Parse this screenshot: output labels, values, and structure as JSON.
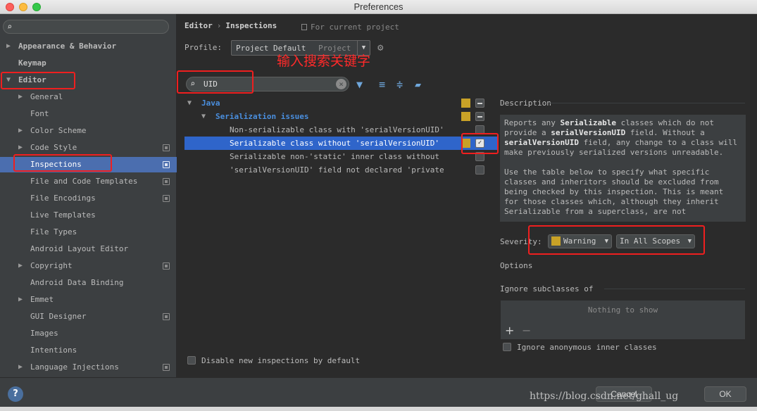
{
  "window": {
    "title": "Preferences"
  },
  "left": {
    "items": [
      {
        "label": "Appearance & Behavior",
        "bold": true,
        "arrow": "right"
      },
      {
        "label": "Keymap",
        "bold": true
      },
      {
        "label": "Editor",
        "bold": true,
        "arrow": "down"
      },
      {
        "label": "General",
        "arrow": "right"
      },
      {
        "label": "Font"
      },
      {
        "label": "Color Scheme",
        "arrow": "right"
      },
      {
        "label": "Code Style",
        "arrow": "right",
        "copy": true
      },
      {
        "label": "Inspections",
        "selected": true,
        "copy": true
      },
      {
        "label": "File and Code Templates",
        "copy": true
      },
      {
        "label": "File Encodings",
        "copy": true
      },
      {
        "label": "Live Templates"
      },
      {
        "label": "File Types"
      },
      {
        "label": "Android Layout Editor"
      },
      {
        "label": "Copyright",
        "arrow": "right",
        "copy": true
      },
      {
        "label": "Android Data Binding"
      },
      {
        "label": "Emmet",
        "arrow": "right"
      },
      {
        "label": "GUI Designer",
        "copy": true
      },
      {
        "label": "Images"
      },
      {
        "label": "Intentions"
      },
      {
        "label": "Language Injections",
        "arrow": "right",
        "copy": true
      }
    ]
  },
  "header": {
    "crumb1": "Editor",
    "crumb_sep": "›",
    "crumb2": "Inspections",
    "for_project": "For current project",
    "profile_label": "Profile:",
    "profile_value": "Project Default",
    "profile_type": "Project"
  },
  "annotation": {
    "text": "输入搜索关键字"
  },
  "search": {
    "value": "UID"
  },
  "tree": {
    "group": "Java",
    "subgroup": "Serialization issues",
    "rows": [
      {
        "label": "Non-serializable class with 'serialVersionUID'",
        "checked": false
      },
      {
        "label": "Serializable class without 'serialVersionUID'",
        "checked": true,
        "selected": true
      },
      {
        "label": "Serializable non-'static' inner class without",
        "checked": false
      },
      {
        "label": "'serialVersionUID' field not declared 'private",
        "checked": false
      }
    ],
    "disable_new": "Disable new inspections by default"
  },
  "description": {
    "heading": "Description",
    "p1_a": "Reports any ",
    "p1_b": "Serializable",
    "p1_c": " classes which do not provide a ",
    "p1_d": "serialVersionUID",
    "p1_e": " field. Without a ",
    "p1_f": "serialVersionUID",
    "p1_g": " field, any change to a class will make previously serialized versions unreadable.",
    "p2": "Use the table below to specify what specific classes and inheritors should be excluded from being checked by this inspection. This is meant for those classes which, although they inherit Serializable from a superclass, are not"
  },
  "severity": {
    "label": "Severity:",
    "value": "Warning",
    "scope": "In All Scopes",
    "color": "#c9a227"
  },
  "options": {
    "heading": "Options",
    "ignore_heading": "Ignore subclasses of",
    "empty": "Nothing to show",
    "ignore_anonymous": "Ignore anonymous inner classes"
  },
  "bottom": {
    "help": "?",
    "cancel": "Cancel",
    "ok": "OK",
    "watermark": "https://blog.csdn.net/ghall_ug"
  }
}
